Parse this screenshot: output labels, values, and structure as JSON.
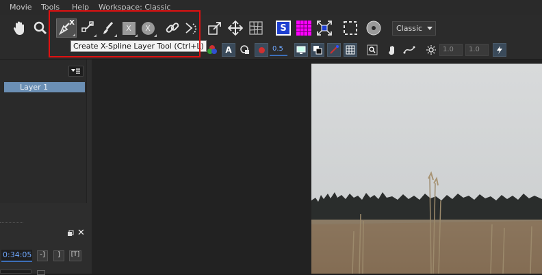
{
  "menu": {
    "items": [
      "Movie",
      "Tools",
      "Help"
    ],
    "workspace_label": "Workspace: Classic"
  },
  "toolbar": {
    "workspace_select": "Classic",
    "tooltip": "Create X-Spline Layer Tool (Ctrl+L)",
    "icon_letters": {
      "x_badge": "X",
      "s_badge": "S"
    }
  },
  "toolbar2": {
    "opacity_value": "0.5",
    "field_a": "1.0",
    "field_b": "1.0"
  },
  "layers": {
    "items": [
      "Layer 1"
    ]
  },
  "timeline": {
    "time_value": "0:34:05",
    "btn_a": "-]",
    "btn_b": "]",
    "btn_c": "[T]"
  },
  "colors": {
    "accent": "#6b8fb4",
    "highlight_border": "#e01010",
    "magenta": "#ff00ff",
    "s_blue": "#1e3fd0"
  }
}
